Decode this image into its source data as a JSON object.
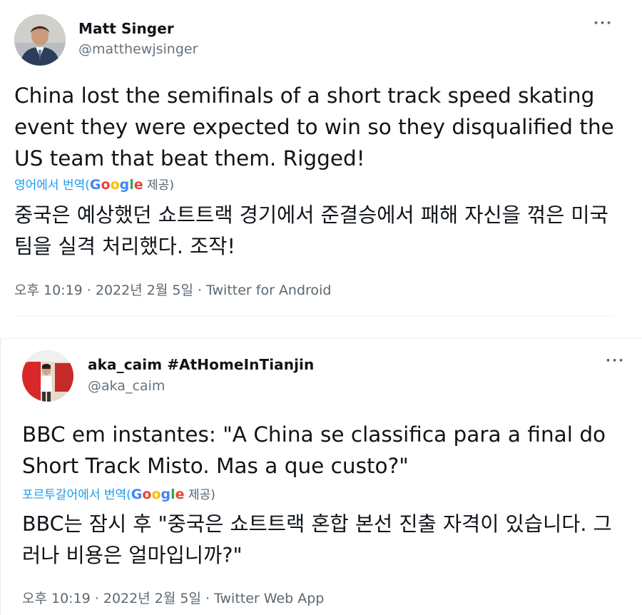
{
  "tweets": [
    {
      "author_name": "Matt Singer",
      "handle": "@matthewjsinger",
      "more_label": "•••",
      "text": "China lost the semifinals of a short track speed skating event they were expected to win so they disqualified the US team that beat them. Rigged!",
      "translate_prefix": "영어에서 번역(",
      "translate_suffix": " 제공)",
      "translated_text": "중국은 예상했던 쇼트트랙 경기에서 준결승에서 패해 자신을 꺾은 미국팀을 실격 처리했다. 조작!",
      "meta": "오후 10:19 · 2022년 2월 5일 · Twitter for Android"
    },
    {
      "author_name": "aka_caim #AtHomeInTianjin",
      "handle": "@aka_caim",
      "more_label": "•••",
      "text": "BBC em instantes: \"A China se classifica para a final do Short Track Misto. Mas a que custo?\"",
      "translate_prefix": "포르투갈어에서 번역(",
      "translate_suffix": " 제공)",
      "translated_text": "BBC는 잠시 후 \"중국은 쇼트트랙 혼합 본선 진출 자격이 있습니다. 그러나 비용은 얼마입니까?\"",
      "meta": "오후 10:19 · 2022년 2월 5일 · Twitter Web App"
    }
  ],
  "google_logo": {
    "letters": [
      "G",
      "o",
      "o",
      "g",
      "l",
      "e"
    ],
    "colors": [
      "#4285f4",
      "#ea4335",
      "#fbbc05",
      "#4285f4",
      "#34a853",
      "#ea4335"
    ]
  },
  "colors": {
    "link_blue": "#1d9bf0",
    "secondary_gray": "#5b6770",
    "text_dark": "#0f1419"
  }
}
